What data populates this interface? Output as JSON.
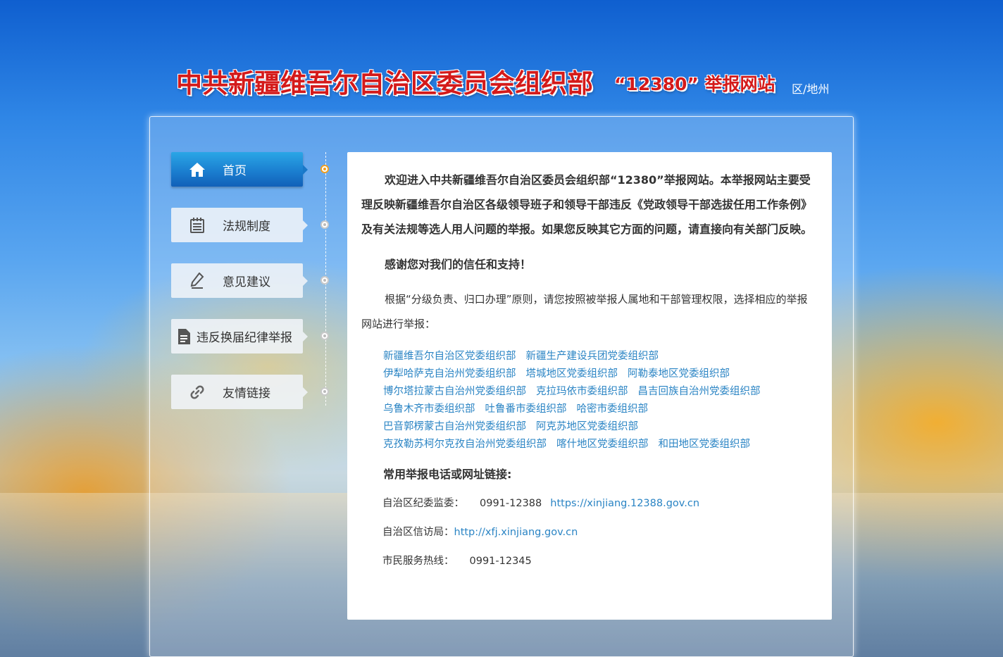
{
  "header": {
    "title": "中共新疆维吾尔自治区委员会组织部",
    "subtitle": "“12380” 举报网站",
    "region_link": "区/地州"
  },
  "nav": {
    "items": [
      {
        "label": "首页",
        "icon": "home-icon",
        "active": true
      },
      {
        "label": "法规制度",
        "icon": "calendar-list-icon",
        "active": false
      },
      {
        "label": "意见建议",
        "icon": "pen-icon",
        "active": false
      },
      {
        "label": "违反换届纪律举报",
        "icon": "document-icon",
        "active": false
      },
      {
        "label": "友情链接",
        "icon": "link-icon",
        "active": false
      }
    ]
  },
  "content": {
    "intro": "欢迎进入中共新疆维吾尔自治区委员会组织部“12380”举报网站。本举报网站主要受理反映新疆维吾尔自治区各级领导班子和领导干部违反《党政领导干部选拔任用工作条例》及有关法规等选人用人问题的举报。如果您反映其它方面的问题，请直接向有关部门反映。",
    "thanks": "感谢您对我们的信任和支持！",
    "principle": "根据“分级负责、归口办理”原则，请您按照被举报人属地和干部管理权限，选择相应的举报网站进行举报：",
    "link_rows": [
      [
        "新疆维吾尔自治区党委组织部",
        "新疆生产建设兵团党委组织部"
      ],
      [
        "伊犁哈萨克自治州党委组织部",
        "塔城地区党委组织部",
        "阿勒泰地区党委组织部"
      ],
      [
        "博尔塔拉蒙古自治州党委组织部",
        "克拉玛依市委组织部",
        "昌吉回族自治州党委组织部"
      ],
      [
        "乌鲁木齐市委组织部",
        "吐鲁番市委组织部",
        "哈密市委组织部"
      ],
      [
        "巴音郭楞蒙古自治州党委组织部",
        "阿克苏地区党委组织部"
      ],
      [
        "克孜勒苏柯尔克孜自治州党委组织部",
        "喀什地区党委组织部",
        "和田地区党委组织部"
      ]
    ],
    "contacts_title": "常用举报电话或网址链接:",
    "contacts": [
      {
        "label": "自治区纪委监委：",
        "phone": "0991-12388",
        "url": "https://xinjiang.12388.gov.cn"
      },
      {
        "label": "自治区信访局：",
        "phone": "",
        "url": "http://xfj.xinjiang.gov.cn"
      },
      {
        "label": "市民服务热线：",
        "phone": "0991-12345",
        "url": ""
      }
    ]
  },
  "colors": {
    "title_red": "#d41a1a",
    "nav_active": "#1b7fd0",
    "link_blue": "#2a84c4",
    "timeline_active": "#f0a020"
  }
}
